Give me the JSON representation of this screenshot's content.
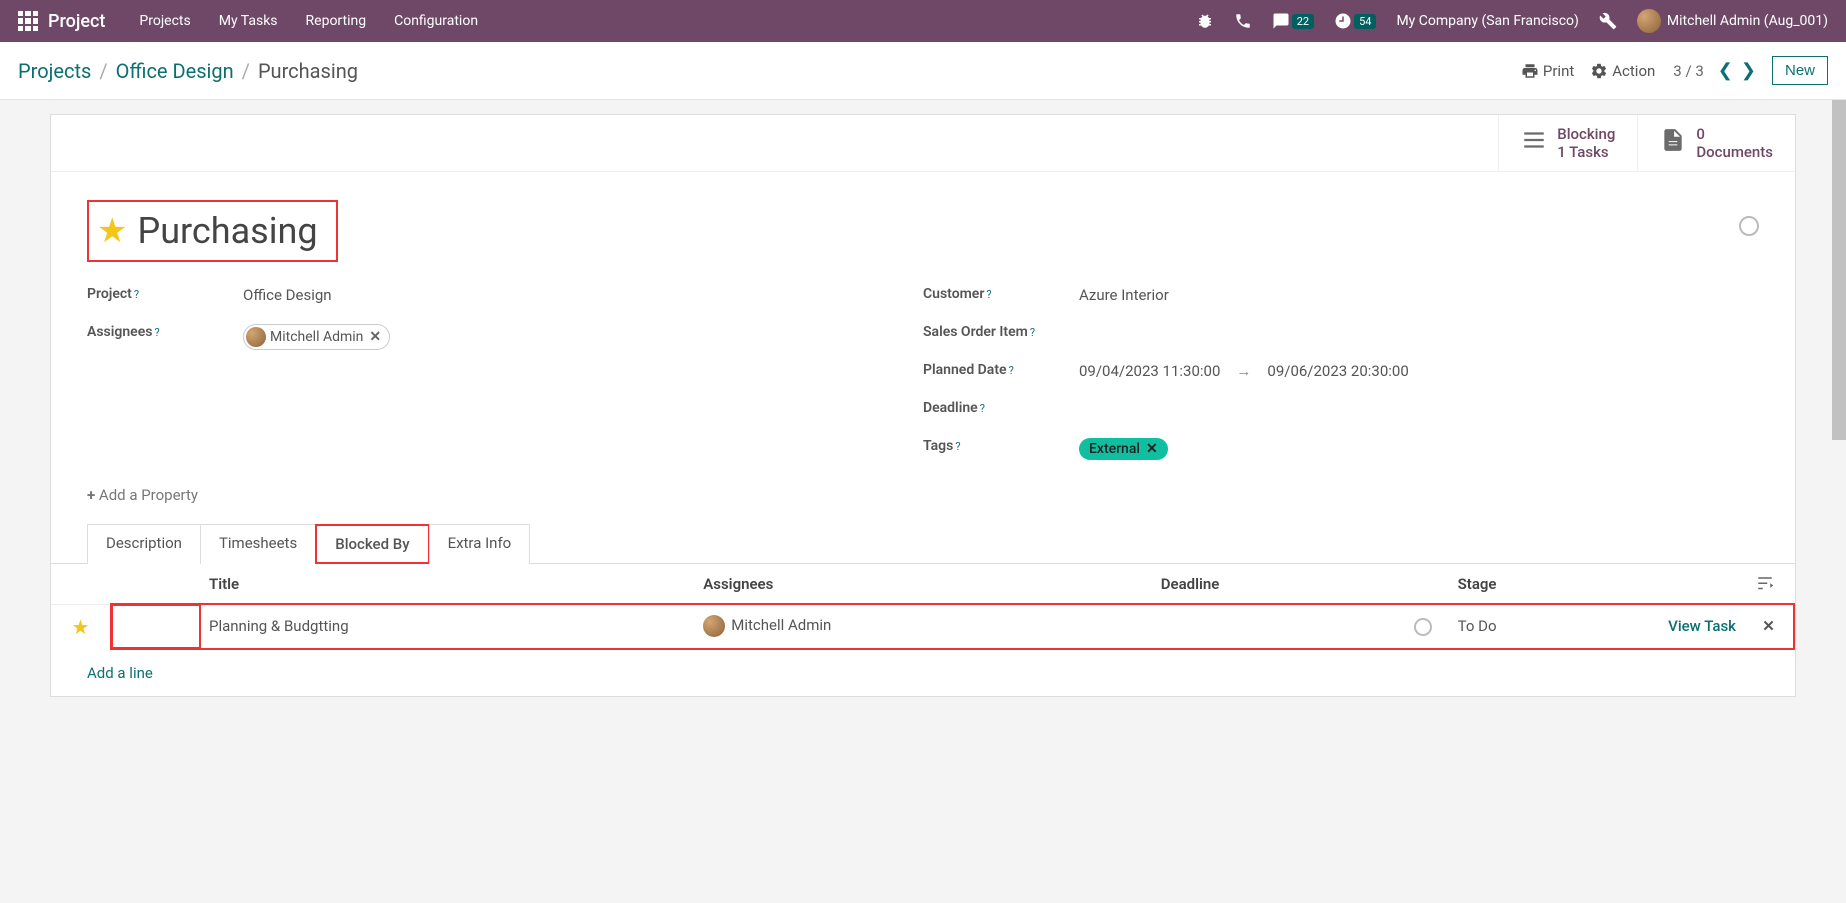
{
  "navbar": {
    "brand": "Project",
    "menu": [
      "Projects",
      "My Tasks",
      "Reporting",
      "Configuration"
    ],
    "chat_badge": "22",
    "activity_badge": "54",
    "company": "My Company (San Francisco)",
    "user": "Mitchell Admin (Aug_001)"
  },
  "controlbar": {
    "crumb1": "Projects",
    "crumb2": "Office Design",
    "crumb3": "Purchasing",
    "print_label": "Print",
    "action_label": "Action",
    "pager": "3 / 3",
    "new_label": "New"
  },
  "stats": {
    "blocking_line1": "Blocking",
    "blocking_line2": "1 Tasks",
    "docs_line1": "0",
    "docs_line2": "Documents"
  },
  "task": {
    "title": "Purchasing",
    "labels": {
      "project": "Project",
      "assignees": "Assignees",
      "customer": "Customer",
      "sales_order_item": "Sales Order Item",
      "planned_date": "Planned Date",
      "deadline": "Deadline",
      "tags": "Tags"
    },
    "project": "Office Design",
    "assignee_name": "Mitchell Admin",
    "customer": "Azure Interior",
    "planned_start": "09/04/2023 11:30:00",
    "planned_end": "09/06/2023 20:30:00",
    "tag": "External",
    "add_property": "Add a Property"
  },
  "tabs": {
    "description": "Description",
    "timesheets": "Timesheets",
    "blocked_by": "Blocked By",
    "extra_info": "Extra Info"
  },
  "table": {
    "headers": {
      "title": "Title",
      "assignees": "Assignees",
      "deadline": "Deadline",
      "stage": "Stage"
    },
    "row": {
      "title": "Planning & Budgtting",
      "assignee": "Mitchell Admin",
      "stage": "To Do",
      "view_task": "View Task"
    },
    "add_line": "Add a line"
  }
}
